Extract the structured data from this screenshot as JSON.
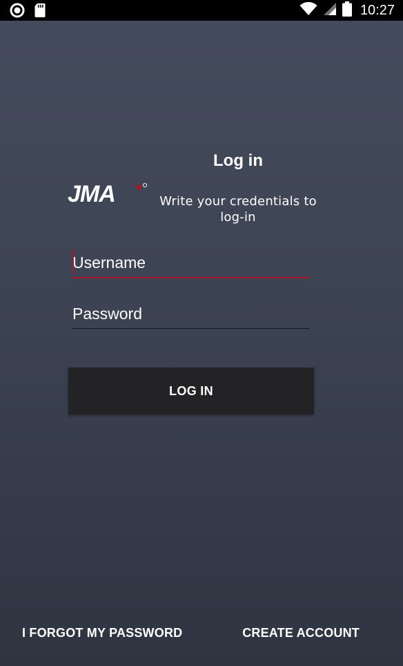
{
  "status_bar": {
    "time": "10:27",
    "icons": [
      "record-icon",
      "sd-card-icon",
      "wifi-icon",
      "signal-icon",
      "battery-icon"
    ]
  },
  "brand": {
    "logo_text": "JMA",
    "logo_color": "#ffffff",
    "accent_color": "#b0142b"
  },
  "header": {
    "title": "Log in",
    "subtitle": "Write your credentials to log-in"
  },
  "form": {
    "username": {
      "value": "",
      "placeholder": "Username"
    },
    "password": {
      "value": "",
      "placeholder": "Password"
    },
    "login_label": "LOG IN"
  },
  "footer": {
    "forgot_label": "I FORGOT MY PASSWORD",
    "create_label": "CREATE ACCOUNT"
  },
  "colors": {
    "background_top": "#454c5d",
    "background_bottom": "#2f3441",
    "button": "#232325",
    "accent": "#b0142b"
  }
}
